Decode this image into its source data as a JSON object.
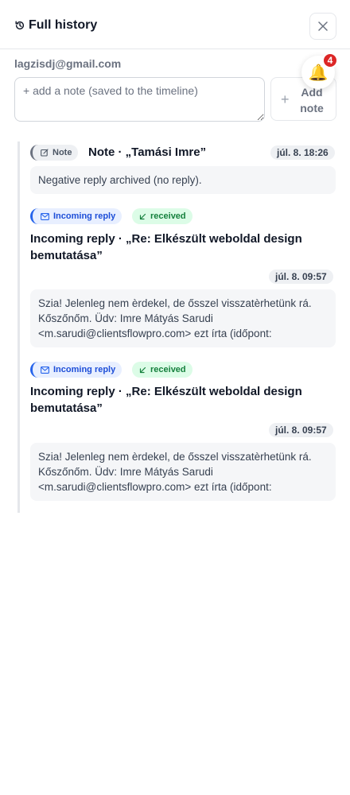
{
  "header": {
    "title": "Full history"
  },
  "contact": {
    "email": "lagzisdj@gmail.com"
  },
  "note_input": {
    "placeholder": "+ add a note (saved to the timeline)",
    "value": ""
  },
  "add_note": {
    "label": "Add note"
  },
  "notifications": {
    "count": "4"
  },
  "entries": [
    {
      "type": "Note",
      "title": "Note · „Tamási Imre”",
      "date": "júl. 8. 18:26",
      "body": "Negative reply archived (no reply)."
    },
    {
      "type": "Incoming reply",
      "status": "received",
      "title": "Incoming reply · „Re: Elkészült weboldal design bemutatása”",
      "date": "júl. 8. 09:57",
      "body": "Szia! Jelenleg nem èrdekel, de ősszel visszatèrhetünk rá. Kőszőnőm. Üdv: Imre Mátyás Sarudi <m.sarudi@clientsflowpro.com> ezt írta (időpont:"
    },
    {
      "type": "Incoming reply",
      "status": "received",
      "title": "Incoming reply · „Re: Elkészült weboldal design bemutatása”",
      "date": "júl. 8. 09:57",
      "body": "Szia! Jelenleg nem èrdekel, de ősszel visszatèrhetünk rá. Kőszőnőm. Üdv: Imre Mátyás Sarudi <m.sarudi@clientsflowpro.com> ezt írta (időpont:"
    }
  ]
}
